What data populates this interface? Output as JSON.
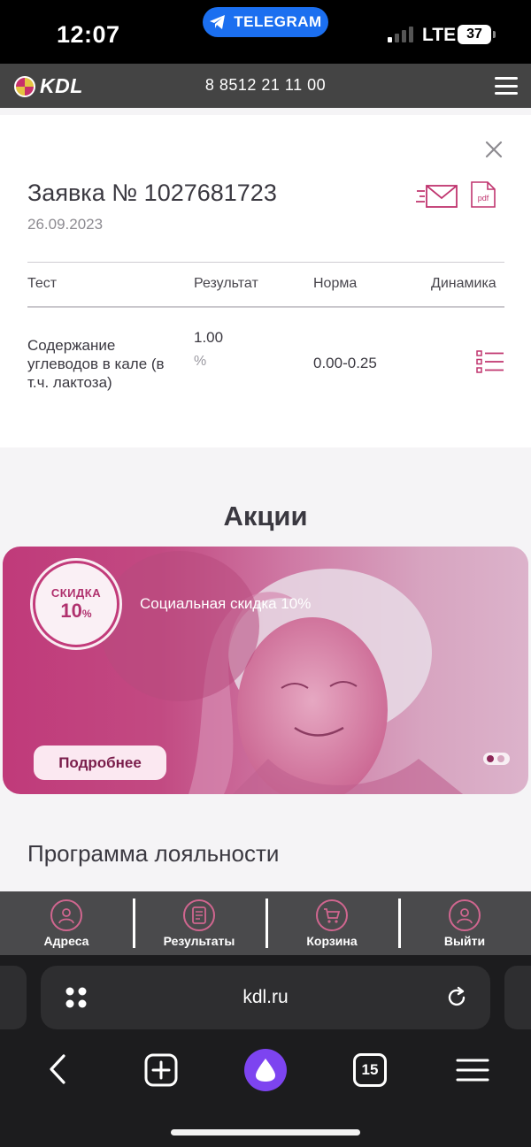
{
  "status": {
    "time": "12:07",
    "telegram": "TELEGRAM",
    "network": "LTE",
    "battery": "37"
  },
  "header": {
    "logo": "KDL",
    "phone": "8 8512 21 11 00"
  },
  "order": {
    "title": "Заявка № 1027681723",
    "date": "26.09.2023",
    "columns": [
      "Тест",
      "Результат",
      "Норма",
      "Динамика"
    ],
    "row": {
      "name": "Содержание углеводов в кале (в т.ч. лактоза)",
      "result": "1.00",
      "unit": "%",
      "norm": "0.00-0.25"
    }
  },
  "promos": {
    "title": "Акции",
    "badge_line1": "СКИДКА",
    "badge_value": "10",
    "badge_unit": "%",
    "text": "Социальная скидка 10%",
    "button": "Подробнее"
  },
  "loyalty": {
    "title": "Программа лояльности"
  },
  "nav": {
    "items": [
      "Адреса",
      "Результаты",
      "Корзина",
      "Выйти"
    ]
  },
  "browser": {
    "url": "kdl.ru",
    "tabs_count": "15"
  },
  "colors": {
    "accent": "#c0356f",
    "header_bg": "#444444",
    "nav_bg": "#4a4a4c"
  }
}
